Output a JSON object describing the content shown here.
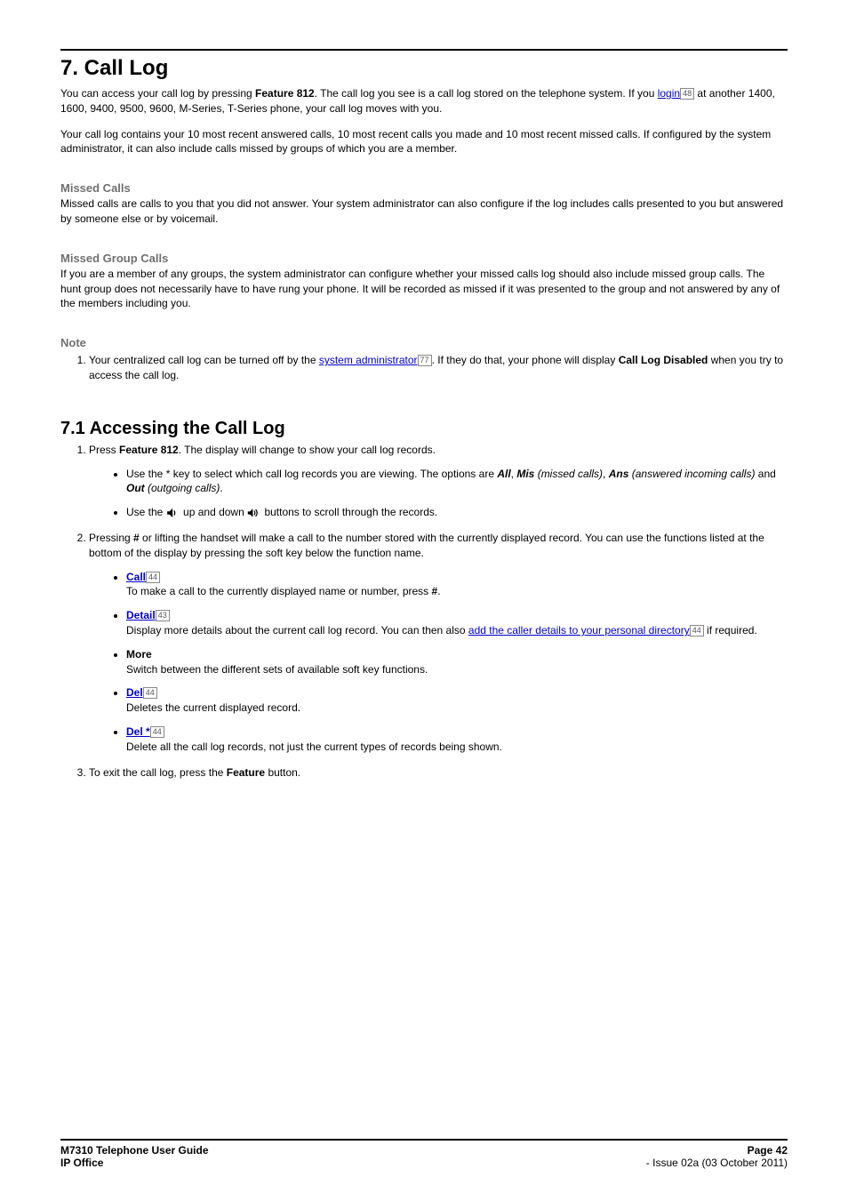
{
  "heading_main": "7. Call Log",
  "intro_p1_a": "You can access your call log by pressing ",
  "intro_p1_feature": "Feature 812",
  "intro_p1_b": ". The call log you see is a call log stored on the telephone system. If you ",
  "intro_login_link": "login",
  "intro_login_ref": "48",
  "intro_p1_c": " at another 1400, 1600, 9400, 9500, 9600, M-Series, T-Series phone, your call log moves with you.",
  "intro_p2": "Your call log contains your 10 most recent answered calls, 10 most recent calls you made and 10 most recent missed calls. If configured by the system administrator, it can also include calls missed by groups of which you are a member.",
  "sec_missed_title": "Missed Calls",
  "sec_missed_body": "Missed calls are calls to you that you did not answer. Your system administrator can also configure if the log includes calls presented to you but answered by someone else or by voicemail.",
  "sec_group_title": "Missed Group Calls",
  "sec_group_body": "If you are a member of any groups, the system administrator can configure whether your missed calls log should also include missed group calls. The hunt group does not necessarily have to have rung your phone. It will be recorded as missed if it was presented to the group and not answered by any of the members including you.",
  "sec_note_title": "Note",
  "note_item_a": "Your centralized call log can be turned off by the ",
  "note_sysadmin_link": "system administrator",
  "note_sysadmin_ref": "77",
  "note_item_b": ". If they do that, your phone will display ",
  "note_calllog_disabled": "Call Log Disabled",
  "note_item_c": " when you try to access the call log.",
  "heading_71": "7.1 Accessing the Call Log",
  "step1_a": "Press ",
  "step1_feature": "Feature 812",
  "step1_b": ". The display will change to show your call log records.",
  "step1_bullet1_a": "Use the * key to select which call log records you are viewing. The options are ",
  "step1_bullet1_all": "All",
  "step1_bullet1_comma1": ", ",
  "step1_bullet1_mis": "Mis",
  "step1_bullet1_missed": " (missed calls)",
  "step1_bullet1_comma2": ", ",
  "step1_bullet1_ans": "Ans",
  "step1_bullet1_answered": " (answered incoming calls)",
  "step1_bullet1_and": " and ",
  "step1_bullet1_out": "Out",
  "step1_bullet1_outgoing": " (outgoing calls)",
  "step1_bullet1_period": ".",
  "step1_bullet2_a": "Use the ",
  "step1_bullet2_mid": " up and down ",
  "step1_bullet2_b": " buttons to scroll through the records.",
  "step2_a": "Pressing ",
  "step2_hash": "#",
  "step2_b": " or lifting the handset will make a call to the number stored with the currently displayed record.  You can use the functions listed at the bottom of the display by pressing the soft key below the function name.",
  "func_call_link": "Call",
  "func_call_ref": "44",
  "func_call_body_a": "To make a call to the currently displayed name or number, press ",
  "func_call_body_hash": "#",
  "func_call_body_b": ".",
  "func_detail_link": "Detail",
  "func_detail_ref": "43",
  "func_detail_body_a": "Display more details about the current call log record. You can then also ",
  "func_detail_addlink": "add the caller details to your personal directory",
  "func_detail_addref": "44",
  "func_detail_body_b": " if required.",
  "func_more_label": "More",
  "func_more_body": "Switch between the different sets of available soft key functions.",
  "func_del_link": "Del",
  "func_del_ref": "44",
  "func_del_body": "Deletes the current displayed record.",
  "func_delstar_link": "Del *",
  "func_delstar_ref": "44",
  "func_delstar_body": "Delete all the call log records, not just the current types of records being shown.",
  "step3_a": "To exit the call log, press the ",
  "step3_feature": "Feature",
  "step3_b": " button.",
  "footer": {
    "left_top": "M7310 Telephone User Guide",
    "left_bottom": "IP Office",
    "right_top": "Page 42",
    "right_bottom": "- Issue 02a (03 October 2011)"
  }
}
